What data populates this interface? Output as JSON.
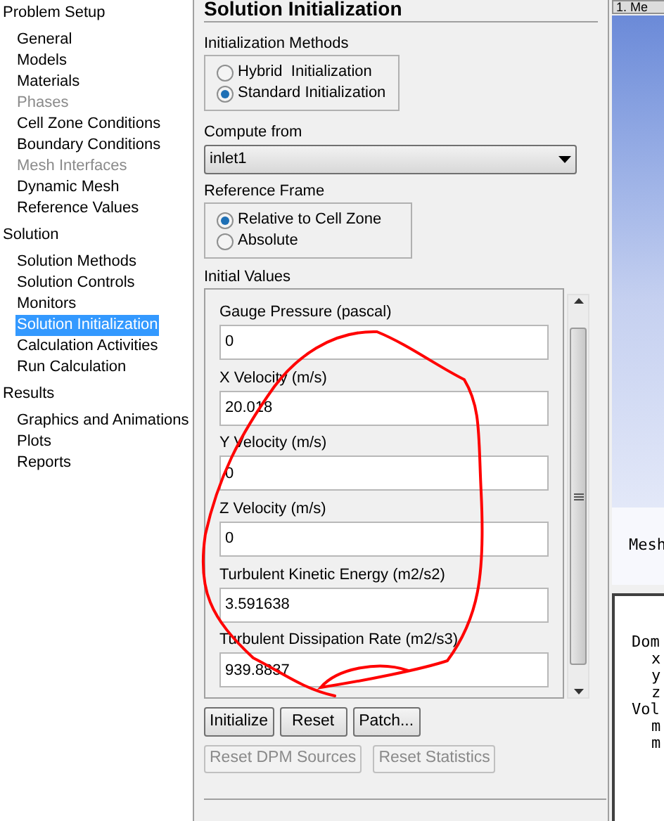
{
  "tree": [
    {
      "label": "Problem Setup",
      "children": [
        {
          "label": "General",
          "selected": false,
          "disabled": false
        },
        {
          "label": "Models",
          "selected": false,
          "disabled": false
        },
        {
          "label": "Materials",
          "selected": false,
          "disabled": false
        },
        {
          "label": "Phases",
          "selected": false,
          "disabled": true
        },
        {
          "label": "Cell Zone Conditions",
          "selected": false,
          "disabled": false
        },
        {
          "label": "Boundary Conditions",
          "selected": false,
          "disabled": false
        },
        {
          "label": "Mesh Interfaces",
          "selected": false,
          "disabled": true
        },
        {
          "label": "Dynamic Mesh",
          "selected": false,
          "disabled": false
        },
        {
          "label": "Reference Values",
          "selected": false,
          "disabled": false
        }
      ]
    },
    {
      "label": "Solution",
      "children": [
        {
          "label": "Solution Methods",
          "selected": false,
          "disabled": false
        },
        {
          "label": "Solution Controls",
          "selected": false,
          "disabled": false
        },
        {
          "label": "Monitors",
          "selected": false,
          "disabled": false
        },
        {
          "label": "Solution Initialization",
          "selected": true,
          "disabled": false
        },
        {
          "label": "Calculation Activities",
          "selected": false,
          "disabled": false
        },
        {
          "label": "Run Calculation",
          "selected": false,
          "disabled": false
        }
      ]
    },
    {
      "label": "Results",
      "children": [
        {
          "label": "Graphics and Animations",
          "selected": false,
          "disabled": false
        },
        {
          "label": "Plots",
          "selected": false,
          "disabled": false
        },
        {
          "label": "Reports",
          "selected": false,
          "disabled": false
        }
      ]
    }
  ],
  "panel": {
    "title": "Solution Initialization",
    "methods": {
      "label": "Initialization Methods",
      "options": [
        {
          "label": "Hybrid  Initialization",
          "selected": false
        },
        {
          "label": "Standard Initialization",
          "selected": true
        }
      ]
    },
    "compute_from": {
      "label": "Compute from",
      "value": "inlet1"
    },
    "reference_frame": {
      "label": "Reference Frame",
      "options": [
        {
          "label": "Relative to Cell Zone",
          "selected": true
        },
        {
          "label": "Absolute",
          "selected": false
        }
      ]
    },
    "initial_values": {
      "label": "Initial Values",
      "fields": [
        {
          "label": "Gauge Pressure (pascal)",
          "value": "0"
        },
        {
          "label": "X Velocity (m/s)",
          "value": "20.018"
        },
        {
          "label": "Y Velocity (m/s)",
          "value": "0"
        },
        {
          "label": "Z Velocity (m/s)",
          "value": "0"
        },
        {
          "label": "Turbulent Kinetic Energy (m2/s2)",
          "value": "3.591638"
        },
        {
          "label": "Turbulent Dissipation Rate (m2/s3)",
          "value": "939.8837"
        }
      ]
    },
    "buttons": [
      {
        "label": "Initialize",
        "disabled": false
      },
      {
        "label": "Reset",
        "disabled": false
      },
      {
        "label": "Patch...",
        "disabled": false
      }
    ],
    "secondary_buttons": [
      {
        "label": "Reset DPM Sources",
        "disabled": true
      },
      {
        "label": "Reset Statistics",
        "disabled": true
      }
    ]
  },
  "graphics": {
    "tab": "1. Me",
    "caption": "Mesh"
  },
  "console": [
    {
      "text": "Dom",
      "children": [
        {
          "text": "x"
        },
        {
          "text": "y"
        },
        {
          "text": "z"
        }
      ]
    },
    {
      "text": "Vol",
      "children": [
        {
          "text": "m"
        },
        {
          "text": "m"
        }
      ]
    }
  ]
}
